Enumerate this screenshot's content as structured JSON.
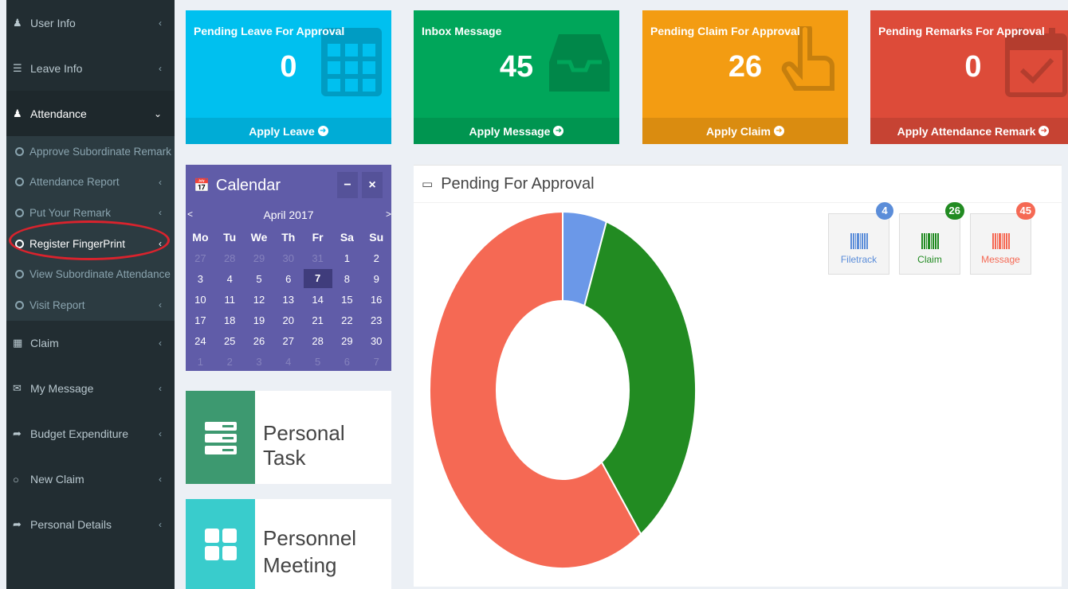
{
  "sidebar": {
    "items": [
      {
        "label": "User Info",
        "icon": "user-icon"
      },
      {
        "label": "Leave Info",
        "icon": "bed-icon"
      },
      {
        "label": "Attendance",
        "icon": "user-plus-icon"
      },
      {
        "label": "Claim",
        "icon": "table-icon"
      },
      {
        "label": "My Message",
        "icon": "envelope-icon"
      },
      {
        "label": "Budget Expenditure",
        "icon": "share-icon"
      },
      {
        "label": "New Claim",
        "icon": "circle-icon"
      },
      {
        "label": "Personal Details",
        "icon": "share-icon"
      }
    ],
    "attendance_sub": [
      "Approve Subordinate Remark",
      "Attendance Report",
      "Put Your Remark",
      "Register FingerPrint",
      "View Subordinate Attendance",
      "Visit Report"
    ]
  },
  "stats": [
    {
      "title": "Pending Leave For Approval",
      "value": "0",
      "footer": "Apply Leave",
      "color": "#00c0ef",
      "icon": "calendar-grid-icon"
    },
    {
      "title": "Inbox Message",
      "value": "45",
      "footer": "Apply Message",
      "color": "#00a65a",
      "icon": "inbox-icon"
    },
    {
      "title": "Pending Claim For Approval",
      "value": "26",
      "footer": "Apply Claim",
      "color": "#f39c12",
      "icon": "hand-pointer-icon"
    },
    {
      "title": "Pending Remarks For Approval",
      "value": "0",
      "footer": "Apply Attendance Remark",
      "color": "#dd4b39",
      "icon": "calendar-check-icon"
    }
  ],
  "calendar": {
    "title": "Calendar",
    "month": "April 2017",
    "prev": "<",
    "next": ">",
    "minimize": "−",
    "close": "×",
    "days": [
      "Mo",
      "Tu",
      "We",
      "Th",
      "Fr",
      "Sa",
      "Su"
    ],
    "weeks": [
      [
        "27",
        "28",
        "29",
        "30",
        "31",
        "1",
        "2"
      ],
      [
        "3",
        "4",
        "5",
        "6",
        "7",
        "8",
        "9"
      ],
      [
        "10",
        "11",
        "12",
        "13",
        "14",
        "15",
        "16"
      ],
      [
        "17",
        "18",
        "19",
        "20",
        "21",
        "22",
        "23"
      ],
      [
        "24",
        "25",
        "26",
        "27",
        "28",
        "29",
        "30"
      ],
      [
        "1",
        "2",
        "3",
        "4",
        "5",
        "6",
        "7"
      ]
    ],
    "today": "7"
  },
  "info": {
    "task_label": "Personal Task",
    "meeting_label_1": "Personnel",
    "meeting_label_2": "Meeting",
    "task_color": "#3d9970",
    "meeting_color": "#39cccc"
  },
  "pending": {
    "title": "Pending For Approval",
    "buttons": [
      {
        "label": "Filetrack",
        "badge": "4",
        "color": "#5b8dd9"
      },
      {
        "label": "Claim",
        "badge": "26",
        "color": "#228b22"
      },
      {
        "label": "Message",
        "badge": "45",
        "color": "#f56954"
      }
    ]
  },
  "chart_data": {
    "type": "donut",
    "categories": [
      "Filetrack",
      "Claim",
      "Message"
    ],
    "values": [
      4,
      26,
      45
    ],
    "colors": [
      "#6b98e8",
      "#228b22",
      "#f56954"
    ]
  }
}
